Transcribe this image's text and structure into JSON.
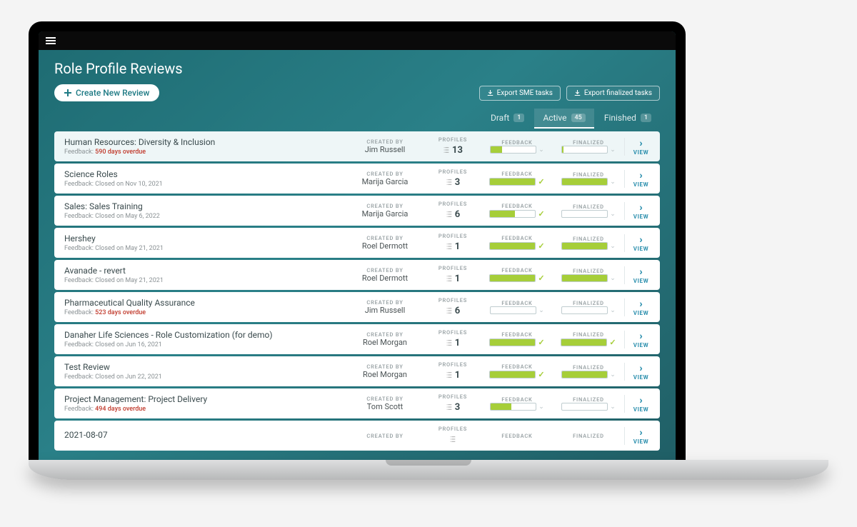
{
  "page_title": "Role Profile Reviews",
  "create_button": "Create New Review",
  "export_sme": "Export SME tasks",
  "export_finalized": "Export finalized tasks",
  "tabs": {
    "draft": {
      "label": "Draft",
      "count": "1"
    },
    "active": {
      "label": "Active",
      "count": "45"
    },
    "finished": {
      "label": "Finished",
      "count": "1"
    }
  },
  "labels": {
    "created_by": "CREATED BY",
    "profiles": "PROFILES",
    "feedback": "FEEDBACK",
    "finalized": "FINALIZED",
    "view": "VIEW",
    "feedback_prefix": "Feedback: "
  },
  "rows": [
    {
      "title": "Human Resources: Diversity & Inclusion",
      "fb": "590 days overdue",
      "overdue": true,
      "creator": "Jim Russell",
      "profiles": "13",
      "feedback_pct": 25,
      "feedback_check": false,
      "finalized_pct": 3,
      "finalized_check": false,
      "highlight": true
    },
    {
      "title": "Science Roles",
      "fb": "Closed on Nov 10, 2021",
      "overdue": false,
      "creator": "Marija Garcia",
      "profiles": "3",
      "feedback_pct": 100,
      "feedback_check": true,
      "finalized_pct": 100,
      "finalized_check": false
    },
    {
      "title": "Sales: Sales Training",
      "fb": "Closed on May 6, 2022",
      "overdue": false,
      "creator": "Marija Garcia",
      "profiles": "6",
      "feedback_pct": 55,
      "feedback_check": true,
      "finalized_pct": 0,
      "finalized_check": false
    },
    {
      "title": "Hershey",
      "fb": "Closed on May 21, 2021",
      "overdue": false,
      "creator": "Roel Dermott",
      "profiles": "1",
      "feedback_pct": 100,
      "feedback_check": true,
      "finalized_pct": 100,
      "finalized_check": false
    },
    {
      "title": "Avanade - revert",
      "fb": "Closed on May 21, 2021",
      "overdue": false,
      "creator": "Roel Dermott",
      "profiles": "1",
      "feedback_pct": 100,
      "feedback_check": true,
      "finalized_pct": 100,
      "finalized_check": false
    },
    {
      "title": "Pharmaceutical Quality Assurance",
      "fb": "523 days overdue",
      "overdue": true,
      "creator": "Jim Russell",
      "profiles": "6",
      "feedback_pct": 0,
      "feedback_check": false,
      "finalized_pct": 0,
      "finalized_check": false
    },
    {
      "title": "Danaher Life Sciences - Role Customization (for demo)",
      "fb": "Closed on Jun 16, 2021",
      "overdue": false,
      "creator": "Roel Morgan",
      "profiles": "1",
      "feedback_pct": 100,
      "feedback_check": true,
      "finalized_pct": 100,
      "finalized_check": true
    },
    {
      "title": "Test Review",
      "fb": "Closed on Jun 22, 2021",
      "overdue": false,
      "creator": "Roel Morgan",
      "profiles": "1",
      "feedback_pct": 100,
      "feedback_check": true,
      "finalized_pct": 100,
      "finalized_check": false
    },
    {
      "title": "Project Management: Project Delivery",
      "fb": "494 days overdue",
      "overdue": true,
      "creator": "Tom Scott",
      "profiles": "3",
      "feedback_pct": 45,
      "feedback_check": false,
      "finalized_pct": 0,
      "finalized_check": false
    },
    {
      "title": "2021-08-07",
      "fb": "",
      "overdue": false,
      "creator": "",
      "profiles": "",
      "feedback_pct": 0,
      "feedback_check": false,
      "finalized_pct": 0,
      "finalized_check": false,
      "partial": true
    }
  ]
}
